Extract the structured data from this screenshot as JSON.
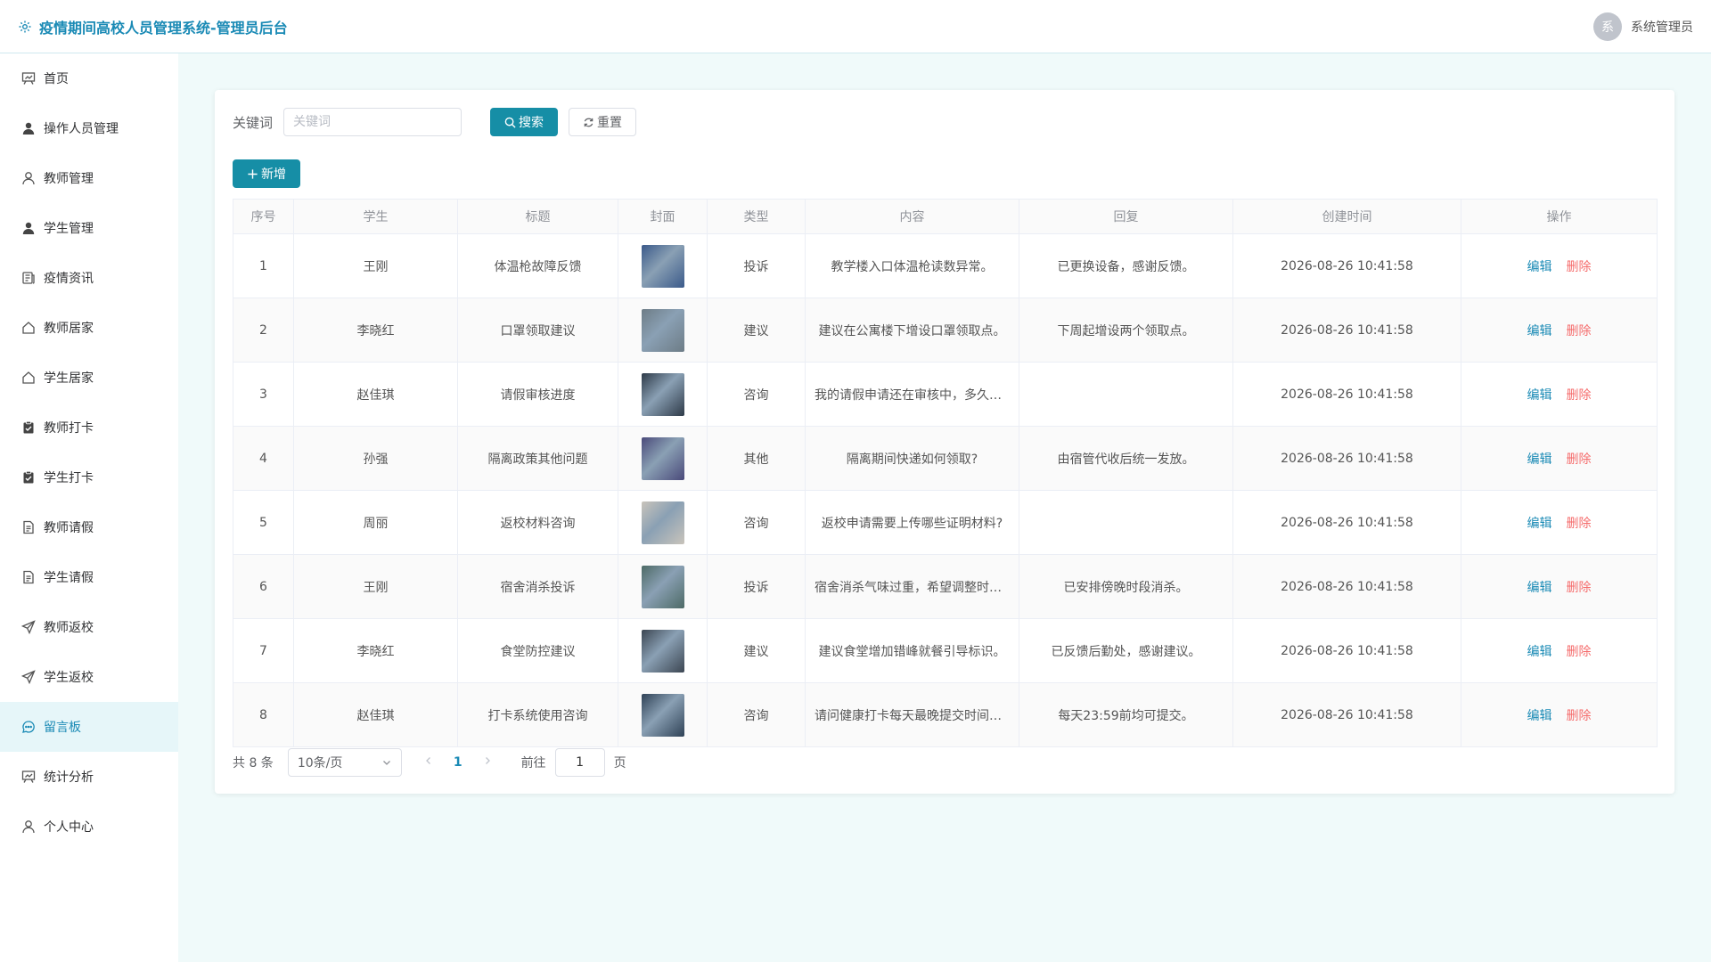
{
  "header": {
    "title": "疫情期间高校人员管理系统-管理员后台",
    "avatar_char": "系",
    "username": "系统管理员"
  },
  "sidebar": {
    "items": [
      {
        "label": "首页",
        "icon": "chart-board-icon"
      },
      {
        "label": "操作人员管理",
        "icon": "user-filled-icon"
      },
      {
        "label": "教师管理",
        "icon": "user-icon"
      },
      {
        "label": "学生管理",
        "icon": "user-filled-icon"
      },
      {
        "label": "疫情资讯",
        "icon": "news-icon"
      },
      {
        "label": "教师居家",
        "icon": "house-icon"
      },
      {
        "label": "学生居家",
        "icon": "house-icon"
      },
      {
        "label": "教师打卡",
        "icon": "clipboard-check-icon"
      },
      {
        "label": "学生打卡",
        "icon": "clipboard-check-icon"
      },
      {
        "label": "教师请假",
        "icon": "document-icon"
      },
      {
        "label": "学生请假",
        "icon": "document-icon"
      },
      {
        "label": "教师返校",
        "icon": "send-icon"
      },
      {
        "label": "学生返校",
        "icon": "send-icon"
      },
      {
        "label": "留言板",
        "icon": "chat-icon",
        "active": true
      },
      {
        "label": "统计分析",
        "icon": "chart-board-icon"
      },
      {
        "label": "个人中心",
        "icon": "user-icon"
      }
    ]
  },
  "search": {
    "label": "关键词",
    "placeholder": "关键词",
    "value": "",
    "search_button": "搜索",
    "reset_button": "重置"
  },
  "toolbar": {
    "add_button": "新增"
  },
  "table": {
    "headers": [
      "序号",
      "学生",
      "标题",
      "封面",
      "类型",
      "内容",
      "回复",
      "创建时间",
      "操作"
    ],
    "rows": [
      {
        "no": "1",
        "student": "王刚",
        "title": "体温枪故障反馈",
        "type": "投诉",
        "content": "教学楼入口体温枪读数异常。",
        "reply": "已更换设备，感谢反馈。",
        "time": "2026-08-26 10:41:58",
        "cover_color": "#3b5a8a"
      },
      {
        "no": "2",
        "student": "李晓红",
        "title": "口罩领取建议",
        "type": "建议",
        "content": "建议在公寓楼下增设口罩领取点。",
        "reply": "下周起增设两个领取点。",
        "time": "2026-08-26 10:41:58",
        "cover_color": "#6d7c86"
      },
      {
        "no": "3",
        "student": "赵佳琪",
        "title": "请假审核进度",
        "type": "咨询",
        "content": "我的请假申请还在审核中，多久能出结果？",
        "reply": "",
        "time": "2026-08-26 10:41:58",
        "cover_color": "#2e3a48"
      },
      {
        "no": "4",
        "student": "孙强",
        "title": "隔离政策其他问题",
        "type": "其他",
        "content": "隔离期间快递如何领取?",
        "reply": "由宿管代收后统一发放。",
        "time": "2026-08-26 10:41:58",
        "cover_color": "#4a4a7a"
      },
      {
        "no": "5",
        "student": "周丽",
        "title": "返校材料咨询",
        "type": "咨询",
        "content": "返校申请需要上传哪些证明材料?",
        "reply": "",
        "time": "2026-08-26 10:41:58",
        "cover_color": "#c9c4bb"
      },
      {
        "no": "6",
        "student": "王刚",
        "title": "宿舍消杀投诉",
        "type": "投诉",
        "content": "宿舍消杀气味过重，希望调整时间。",
        "reply": "已安排傍晚时段消杀。",
        "time": "2026-08-26 10:41:58",
        "cover_color": "#4d6a66"
      },
      {
        "no": "7",
        "student": "李晓红",
        "title": "食堂防控建议",
        "type": "建议",
        "content": "建议食堂增加错峰就餐引导标识。",
        "reply": "已反馈后勤处，感谢建议。",
        "time": "2026-08-26 10:41:58",
        "cover_color": "#3c4652"
      },
      {
        "no": "8",
        "student": "赵佳琪",
        "title": "打卡系统使用咨询",
        "type": "咨询",
        "content": "请问健康打卡每天最晚提交时间是几点？",
        "reply": "每天23:59前均可提交。",
        "time": "2026-08-26 10:41:58",
        "cover_color": "#2f4256"
      }
    ],
    "edit_label": "编辑",
    "delete_label": "删除"
  },
  "pagination": {
    "total_text": "共 8 条",
    "page_size": "10条/页",
    "current_page": "1",
    "goto_label": "前往",
    "goto_value": "1",
    "goto_unit": "页"
  },
  "colors": {
    "accent": "#168ea6",
    "link": "#1a8ab5",
    "danger": "#f56c6c",
    "background": "#f0fafa"
  }
}
